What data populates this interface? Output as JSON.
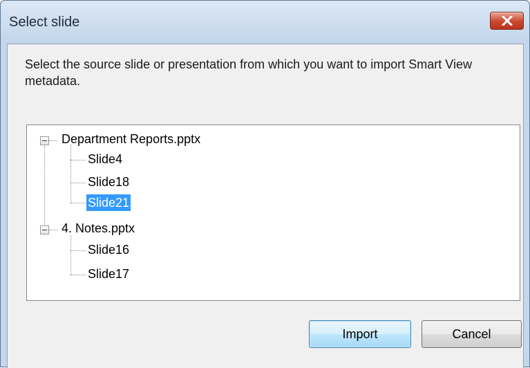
{
  "window": {
    "title": "Select slide",
    "close_icon": "close-icon"
  },
  "instruction": "Select the source slide or presentation from which you want to import Smart View metadata.",
  "tree": {
    "presentations": [
      {
        "name": "Department Reports.pptx",
        "expanded": true,
        "slides": [
          "Slide4",
          "Slide18",
          "Slide21"
        ]
      },
      {
        "name": "4. Notes.pptx",
        "expanded": true,
        "slides": [
          "Slide16",
          "Slide17"
        ]
      }
    ],
    "selected": "Slide21",
    "selection_color": "#3399ff"
  },
  "buttons": {
    "import_label": "Import",
    "cancel_label": "Cancel"
  }
}
